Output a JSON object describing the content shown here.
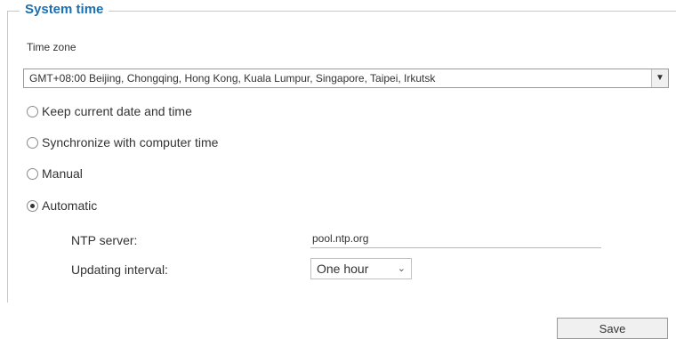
{
  "section": {
    "legend": "System time"
  },
  "timezone": {
    "label": "Time zone",
    "selected": "GMT+08:00 Beijing, Chongqing, Hong Kong, Kuala Lumpur, Singapore, Taipei, Irkutsk"
  },
  "options": [
    {
      "label": "Keep current date and time",
      "checked": false
    },
    {
      "label": "Synchronize with computer time",
      "checked": false
    },
    {
      "label": "Manual",
      "checked": false
    },
    {
      "label": "Automatic",
      "checked": true
    }
  ],
  "ntp": {
    "label": "NTP server:",
    "value": "pool.ntp.org"
  },
  "interval": {
    "label": "Updating interval:",
    "selected": "One hour"
  },
  "save_label": "Save"
}
